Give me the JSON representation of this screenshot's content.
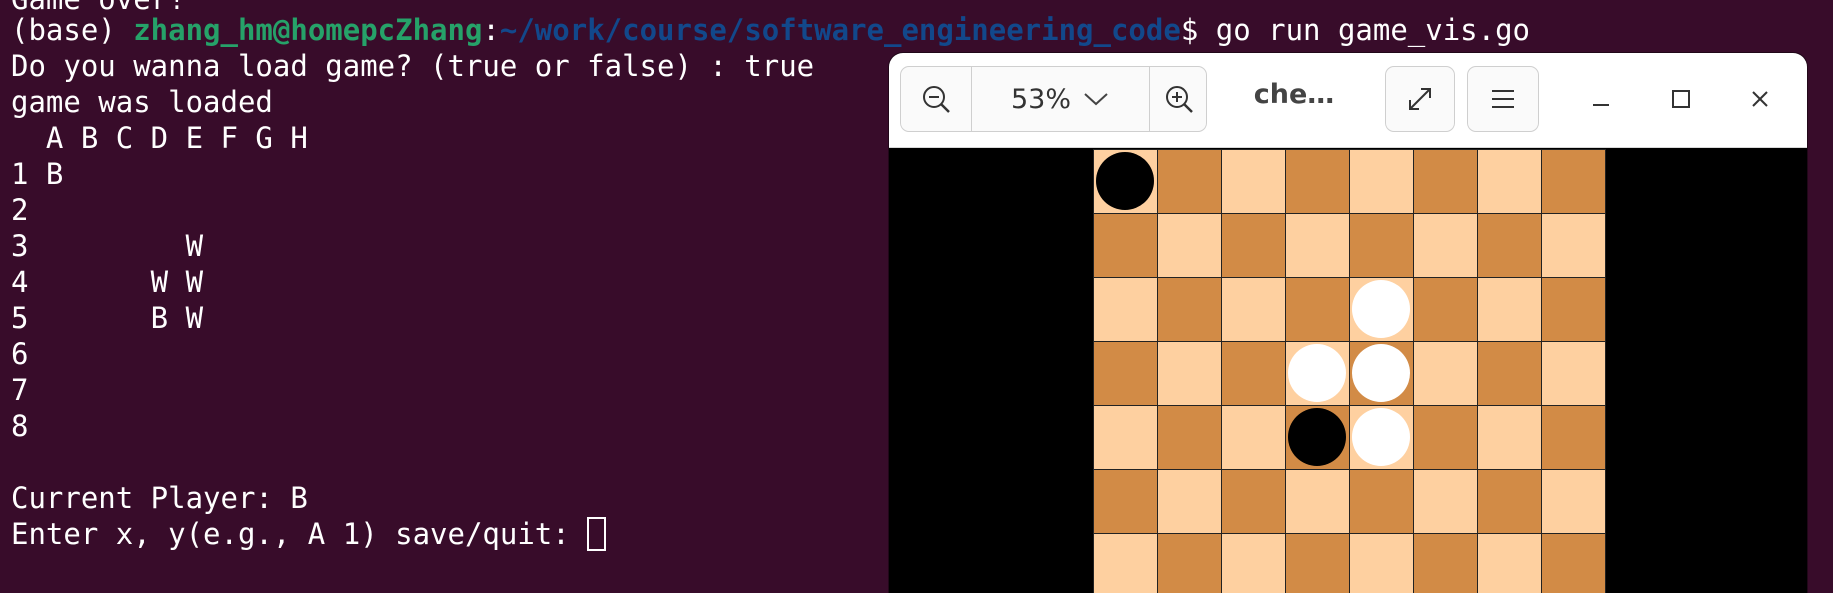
{
  "terminal": {
    "line0": "Game over!",
    "prompt": {
      "env": "(base) ",
      "user": "zhang_hm@homepcZhang",
      "colon": ":",
      "path": "~/work/course/software_engineering_code",
      "dollar": "$ ",
      "command": "go run game_vis.go"
    },
    "load_question": "Do you wanna load game? (true or false) : true",
    "loaded_msg": "game was loaded",
    "board_header": "  A B C D E F G H",
    "board_rows": [
      "1 B",
      "2",
      "3         W",
      "4       W W",
      "5       B W",
      "6",
      "7",
      "8"
    ],
    "current_player": "Current Player: B",
    "input_prompt": "Enter x, y(e.g., A 1) save/quit: "
  },
  "viewer": {
    "zoom_level": "53%",
    "zoom_caret": "﹀",
    "title": "che…",
    "icons": {
      "zoom_out": "zoom-out-icon",
      "zoom_in": "zoom-in-icon",
      "fullscreen": "fullscreen-icon",
      "menu": "hamburger-menu-icon",
      "minimize": "minimize-icon",
      "maximize": "maximize-icon",
      "close": "close-icon"
    },
    "colors": {
      "light_square": "#fed0a0",
      "dark_square": "#d28b46",
      "black_piece": "#000000",
      "white_piece": "#ffffff"
    }
  },
  "board": {
    "rows_visible": 7,
    "cols": 8,
    "pieces": [
      {
        "row": 0,
        "col": 0,
        "color": "black"
      },
      {
        "row": 2,
        "col": 4,
        "color": "white"
      },
      {
        "row": 3,
        "col": 3,
        "color": "white"
      },
      {
        "row": 3,
        "col": 4,
        "color": "white"
      },
      {
        "row": 4,
        "col": 3,
        "color": "black"
      },
      {
        "row": 4,
        "col": 4,
        "color": "white"
      }
    ]
  }
}
